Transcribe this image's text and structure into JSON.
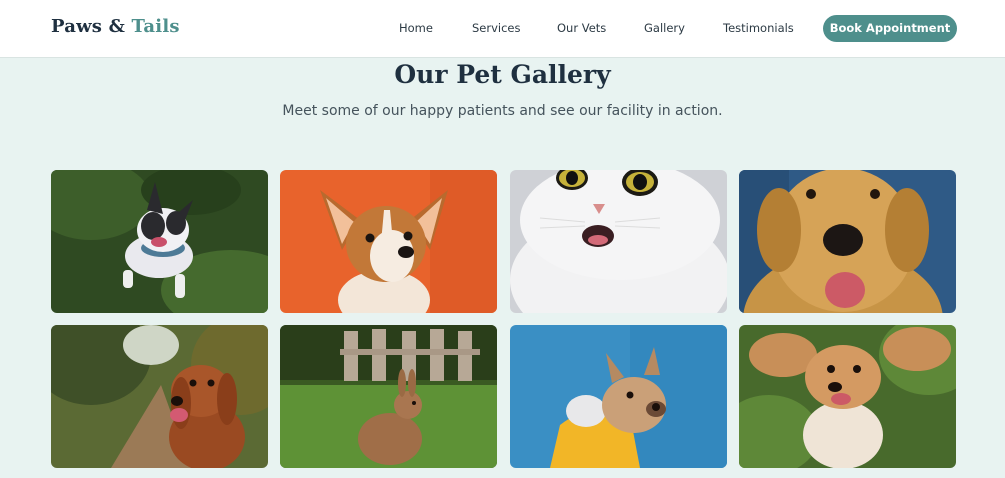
{
  "brand": {
    "name_part1": "Paws",
    "ampersand": "&",
    "name_part2": "Tails"
  },
  "nav": {
    "links": [
      "Home",
      "Services",
      "Our Vets",
      "Gallery",
      "Testimonials"
    ],
    "cta_label": "Book Appointment"
  },
  "gallery": {
    "title": "Our Pet Gallery",
    "subtitle": "Meet some of our happy patients and see our facility in action.",
    "photos": [
      {
        "subject": "French bulldog on grass"
      },
      {
        "subject": "Corgi puppy on orange background"
      },
      {
        "subject": "White cat with surprised face"
      },
      {
        "subject": "Golden retriever on blue background"
      },
      {
        "subject": "Brown spaniel on forest path"
      },
      {
        "subject": "Brown rabbit on grass by fence"
      },
      {
        "subject": "French bulldog in yellow hoodie"
      },
      {
        "subject": "Cocker spaniel lying in grass"
      }
    ]
  },
  "colors": {
    "accent": "#4e8f8c",
    "heading": "#1f3040",
    "background": "#e8f3f1"
  }
}
